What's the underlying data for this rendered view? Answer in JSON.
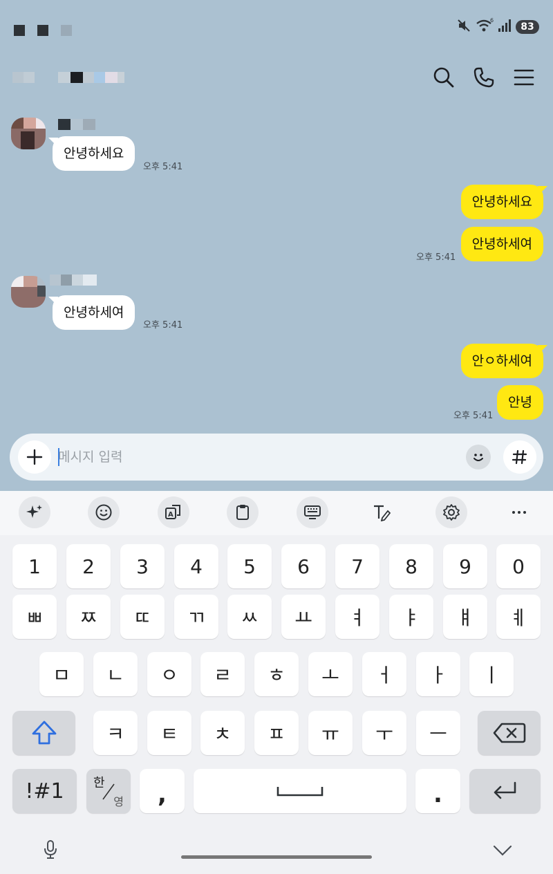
{
  "status_bar": {
    "battery": "83",
    "icons": [
      "mute-icon",
      "wifi-icon",
      "signal-icon",
      "battery-icon"
    ]
  },
  "header": {
    "icons": [
      "search-icon",
      "phone-icon",
      "menu-icon"
    ]
  },
  "messages": [
    {
      "direction": "in",
      "text": "안녕하세요",
      "time": "오후 5:41"
    },
    {
      "direction": "out",
      "text": "안녕하세요"
    },
    {
      "direction": "out",
      "text": "안녕하세여",
      "time": "오후 5:41"
    },
    {
      "direction": "in",
      "text": "안녕하세여",
      "time": "오후 5:41"
    },
    {
      "direction": "out",
      "text": "안ㅇ하세여"
    },
    {
      "direction": "out",
      "text": "안녕",
      "time": "오후 5:41"
    }
  ],
  "input": {
    "placeholder": "메시지 입력",
    "value": ""
  },
  "keyboard": {
    "toolbar": [
      "ai-sparkle-icon",
      "emoji-icon",
      "translate-icon",
      "clipboard-icon",
      "keyboard-mode-icon",
      "text-edit-icon",
      "settings-icon",
      "more-icon"
    ],
    "row_numbers": [
      "1",
      "2",
      "3",
      "4",
      "5",
      "6",
      "7",
      "8",
      "9",
      "0"
    ],
    "row_double": [
      "ㅃ",
      "ㅉ",
      "ㄸ",
      "ㄲ",
      "ㅆ",
      "ㅛ",
      "ㅕ",
      "ㅑ",
      "ㅒ",
      "ㅖ"
    ],
    "row_middle": [
      "ㅁ",
      "ㄴ",
      "ㅇ",
      "ㄹ",
      "ㅎ",
      "ㅗ",
      "ㅓ",
      "ㅏ",
      "ㅣ"
    ],
    "row_bottom": [
      "ㅋ",
      "ㅌ",
      "ㅊ",
      "ㅍ",
      "ㅠ",
      "ㅜ",
      "ㅡ"
    ],
    "symbols_label": "!#1",
    "lang_top": "한",
    "lang_bottom": "영",
    "comma": ",",
    "period": "."
  },
  "colors": {
    "background": "#abc1d1",
    "outgoing_bubble": "#ffe812",
    "incoming_bubble": "#ffffff",
    "keyboard": "#f0f1f4"
  }
}
